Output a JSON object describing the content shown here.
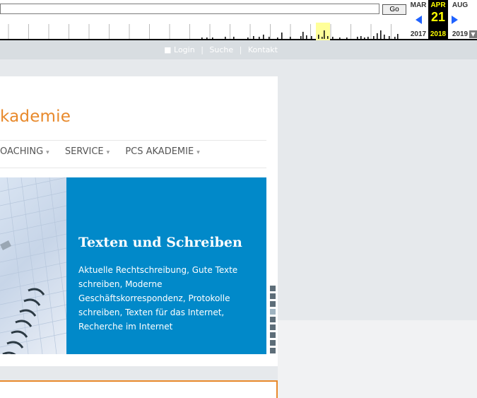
{
  "wayback": {
    "go_label": "Go",
    "months": [
      {
        "month": "MAR",
        "year": "2017"
      },
      {
        "month": "APR",
        "day": "21",
        "year": "2018",
        "current": true
      },
      {
        "month": "AUG",
        "year": "2019"
      }
    ],
    "colors": {
      "accent": "#ffff00",
      "arrow": "#1f62ff"
    },
    "icons": [
      "arrow-left-icon",
      "arrow-right-icon",
      "dropdown-icon"
    ]
  },
  "topbar": {
    "login": "Login",
    "search": "Suche",
    "contact": "Kontakt",
    "separator": "|"
  },
  "site": {
    "logo_text": "kademie",
    "accent": "#e8892b",
    "nav": [
      {
        "label": "OACHING"
      },
      {
        "label": "SERVICE"
      },
      {
        "label": "PCS AKADEMIE"
      }
    ],
    "nav_caret": "▾"
  },
  "hero": {
    "title": "Texten und Schreiben",
    "text": "Aktuelle Rechtschreibung, Gute Texte schreiben,  Moderne Geschäftskorrespondenz, Protokolle schreiben, Texten für das Internet, Recherche im Internet",
    "panel_color": "#0189c9",
    "slides_total": 9,
    "slide_active": 4
  }
}
